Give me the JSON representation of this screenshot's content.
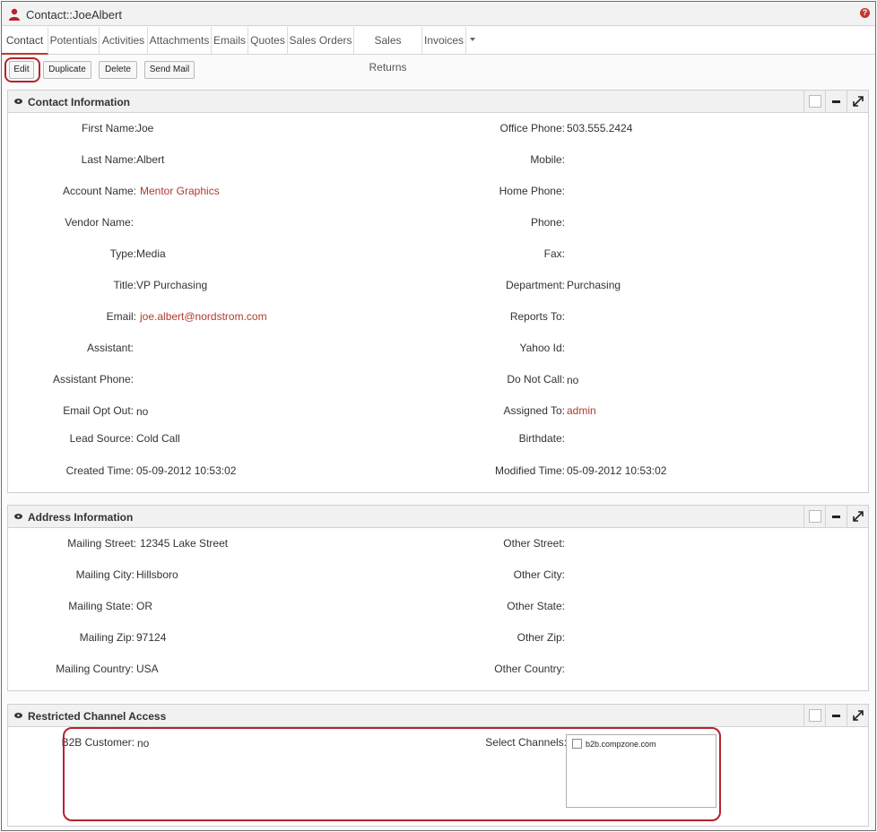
{
  "header": {
    "title": "Contact::JoeAlbert"
  },
  "tabs": [
    "Contact",
    "Potentials",
    "Activities",
    "Attachments",
    "Emails",
    "Quotes",
    "Sales Orders",
    "Sales Returns",
    "Invoices"
  ],
  "actions": {
    "edit": "Edit",
    "duplicate": "Duplicate",
    "delete": "Delete",
    "send_mail": "Send Mail"
  },
  "contact_info": {
    "title": "Contact Information",
    "left": [
      {
        "label": "First Name:",
        "value": "Joe"
      },
      {
        "label": "Last Name:",
        "value": "Albert"
      },
      {
        "label": "Account Name:",
        "value": "Mentor Graphics"
      },
      {
        "label": "Vendor Name:",
        "value": ""
      },
      {
        "label": "Type:",
        "value": "Media"
      },
      {
        "label": "Title:",
        "value": "VP Purchasing"
      },
      {
        "label": "Email:",
        "value": "joe.albert@nordstrom.com"
      },
      {
        "label": "Assistant:",
        "value": ""
      },
      {
        "label": "Assistant Phone:",
        "value": ""
      },
      {
        "label": "Email Opt Out:",
        "value": "no"
      },
      {
        "label": "Lead Source:",
        "value": "Cold Call"
      },
      {
        "label": "Created Time:",
        "value": "05-09-2012 10:53:02"
      }
    ],
    "right": [
      {
        "label": "Office Phone:",
        "value": "503.555.2424"
      },
      {
        "label": "Mobile:",
        "value": ""
      },
      {
        "label": "Home Phone:",
        "value": ""
      },
      {
        "label": "Phone:",
        "value": ""
      },
      {
        "label": "Fax:",
        "value": ""
      },
      {
        "label": "Department:",
        "value": "Purchasing"
      },
      {
        "label": "Reports To:",
        "value": ""
      },
      {
        "label": "Yahoo Id:",
        "value": ""
      },
      {
        "label": "Do Not Call:",
        "value": "no"
      },
      {
        "label": "Assigned To:",
        "value": "admin"
      },
      {
        "label": "Birthdate:",
        "value": ""
      },
      {
        "label": "Modified Time:",
        "value": "05-09-2012 10:53:02"
      }
    ]
  },
  "address_info": {
    "title": "Address Information",
    "left": [
      {
        "label": "Mailing Street:",
        "value": "12345 Lake Street"
      },
      {
        "label": "Mailing City:",
        "value": "Hillsboro"
      },
      {
        "label": "Mailing State:",
        "value": "OR"
      },
      {
        "label": "Mailing Zip:",
        "value": "97124"
      },
      {
        "label": "Mailing Country:",
        "value": "USA"
      }
    ],
    "right": [
      {
        "label": "Other Street:",
        "value": ""
      },
      {
        "label": "Other City:",
        "value": ""
      },
      {
        "label": "Other State:",
        "value": ""
      },
      {
        "label": "Other Zip:",
        "value": ""
      },
      {
        "label": "Other Country:",
        "value": ""
      }
    ]
  },
  "channel_access": {
    "title": "Restricted Channel Access",
    "b2b_label": "B2B Customer:",
    "b2b_value": "no",
    "channels_label": "Select Channels:",
    "channels": [
      {
        "name": "b2b.compzone.com",
        "checked": false
      }
    ]
  },
  "colors": {
    "accent": "#b5232d",
    "link": "#b03a2e"
  }
}
